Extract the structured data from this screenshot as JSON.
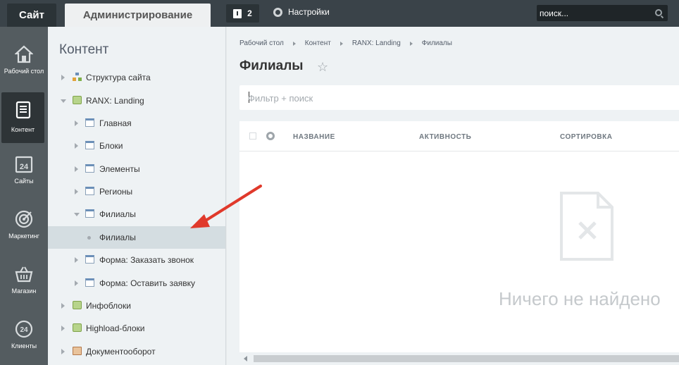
{
  "topbar": {
    "site_tab": "Сайт",
    "admin_tab": "Администрирование",
    "notifications_count": "2",
    "settings_label": "Настройки",
    "search_placeholder": "поиск..."
  },
  "left_menu": [
    {
      "label": "Рабочий стол",
      "icon": "home-icon"
    },
    {
      "label": "Контент",
      "icon": "document-icon",
      "active": true
    },
    {
      "label": "Сайты",
      "icon": "calendar-24-icon"
    },
    {
      "label": "Маркетинг",
      "icon": "target-icon"
    },
    {
      "label": "Магазин",
      "icon": "basket-icon"
    },
    {
      "label": "Клиенты",
      "icon": "clients-24-icon"
    }
  ],
  "tree": {
    "title": "Контент",
    "nodes": [
      {
        "label": "Структура сайта"
      },
      {
        "label": "RANX: Landing"
      },
      {
        "label": "Главная"
      },
      {
        "label": "Блоки"
      },
      {
        "label": "Элементы"
      },
      {
        "label": "Регионы"
      },
      {
        "label": "Филиалы"
      },
      {
        "label": "Филиалы"
      },
      {
        "label": "Форма: Заказать звонок"
      },
      {
        "label": "Форма: Оставить заявку"
      },
      {
        "label": "Инфоблоки"
      },
      {
        "label": "Highload-блоки"
      },
      {
        "label": "Документооборот"
      }
    ]
  },
  "main": {
    "breadcrumbs": [
      "Рабочий стол",
      "Контент",
      "RANX: Landing",
      "Филиалы"
    ],
    "title": "Филиалы",
    "filter_placeholder": "Фильтр + поиск",
    "columns": [
      "НАЗВАНИЕ",
      "АКТИВНОСТЬ",
      "СОРТИРОВКА"
    ],
    "empty_text": "Ничего не найдено"
  },
  "colors": {
    "topbar": "#3a4349",
    "left_menu": "#545c60",
    "annotation_arrow": "#e0392b"
  }
}
